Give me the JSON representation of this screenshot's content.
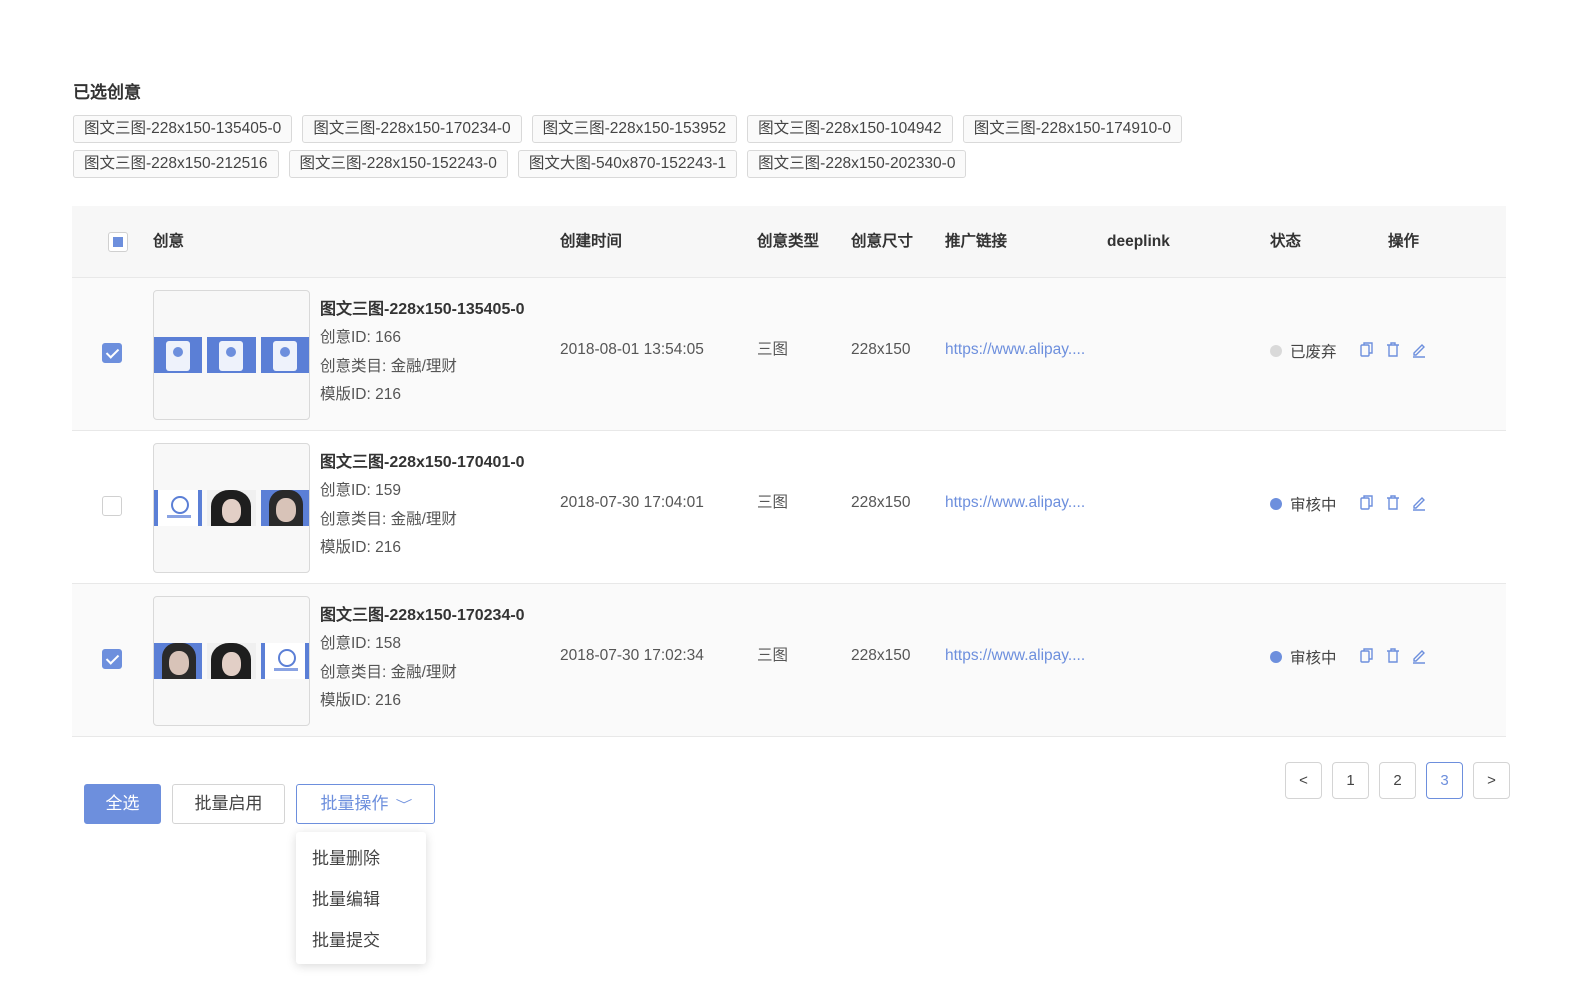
{
  "selected": {
    "title": "已选创意",
    "tags_row1": [
      "图文三图-228x150-135405-0",
      "图文三图-228x150-170234-0",
      "图文三图-228x150-153952",
      "图文三图-228x150-104942",
      "图文三图-228x150-174910-0"
    ],
    "tags_row2": [
      "图文三图-228x150-212516",
      "图文三图-228x150-152243-0",
      "图文大图-540x870-152243-1",
      "图文三图-228x150-202330-0"
    ]
  },
  "table": {
    "headers": {
      "creative": "创意",
      "created_time": "创建时间",
      "type": "创意类型",
      "size": "创意尺寸",
      "promo_link": "推广链接",
      "deeplink": "deeplink",
      "status": "状态",
      "actions": "操作"
    },
    "rows": [
      {
        "checked": true,
        "name": "图文三图-228x150-135405-0",
        "id_line": "创意ID: 166",
        "category_line": "创意类目: 金融/理财",
        "template_line": "模版ID: 216",
        "created": "2018-08-01 13:54:05",
        "type": "三图",
        "size": "228x150",
        "link": "https://www.alipay....",
        "deeplink": "",
        "status": "已废弃",
        "status_color": "#d9d9d9"
      },
      {
        "checked": false,
        "name": "图文三图-228x150-170401-0",
        "id_line": "创意ID: 159",
        "category_line": "创意类目: 金融/理财",
        "template_line": "模版ID: 216",
        "created": "2018-07-30 17:04:01",
        "type": "三图",
        "size": "228x150",
        "link": "https://www.alipay....",
        "deeplink": "",
        "status": "审核中",
        "status_color": "#6d8fdd"
      },
      {
        "checked": true,
        "name": "图文三图-228x150-170234-0",
        "id_line": "创意ID: 158",
        "category_line": "创意类目: 金融/理财",
        "template_line": "模版ID: 216",
        "created": "2018-07-30 17:02:34",
        "type": "三图",
        "size": "228x150",
        "link": "https://www.alipay....",
        "deeplink": "",
        "status": "审核中",
        "status_color": "#6d8fdd"
      }
    ]
  },
  "footer": {
    "select_all": "全选",
    "batch_enable": "批量启用",
    "batch_ops": "批量操作",
    "chevron": "﹀",
    "menu": [
      "批量删除",
      "批量编辑",
      "批量提交"
    ]
  },
  "pagination": {
    "prev": "<",
    "pages": [
      "1",
      "2",
      "3"
    ],
    "current": "3",
    "next": ">"
  },
  "colors": {
    "accent": "#6d8fdd",
    "disabled_dot": "#d9d9d9"
  },
  "icons": [
    "copy-icon",
    "trash-icon",
    "edit-icon"
  ]
}
